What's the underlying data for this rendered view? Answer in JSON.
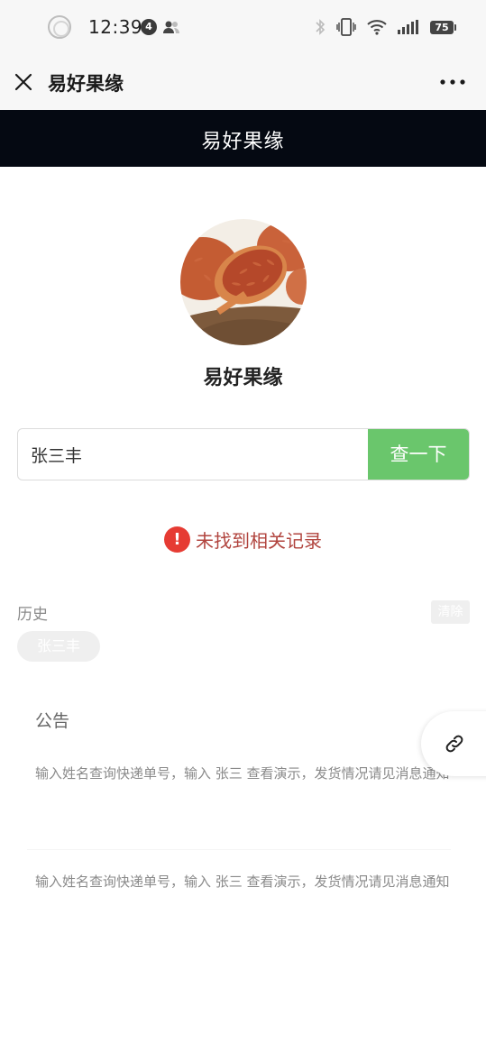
{
  "status_bar": {
    "time": "12:39",
    "notification_count": "4",
    "battery": "75"
  },
  "nav": {
    "title": "易好果缘"
  },
  "header": {
    "title": "易好果缘"
  },
  "shop": {
    "name": "易好果缘"
  },
  "search": {
    "value": "张三丰",
    "button_label": "查一下"
  },
  "result": {
    "error_text": "未找到相关记录",
    "error_icon_glyph": "!"
  },
  "history": {
    "label": "历史",
    "clear_label": "清除",
    "items": [
      "张三丰"
    ]
  },
  "notice": {
    "title": "公告",
    "items": [
      "输入姓名查询快递单号，输入 张三 查看演示，发货情况请见消息通知",
      "输入姓名查询快递单号，输入 张三 查看演示，发货情况请见消息通知"
    ]
  },
  "colors": {
    "header_bg": "#050912",
    "search_button": "#6ac66c",
    "error_icon": "#e63b33",
    "error_text": "#b1443e"
  }
}
